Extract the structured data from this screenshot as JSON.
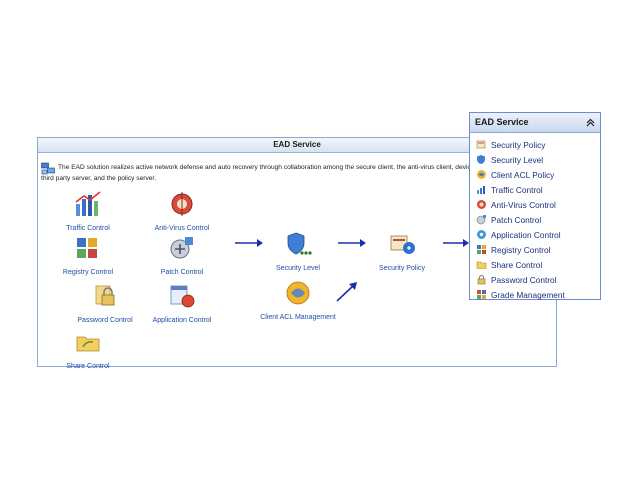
{
  "panel": {
    "title": "EAD Service",
    "intro": "The EAD solution realizes active network defense and auto recovery through collaboration among the secure client, the anti-virus client, device, the third party server, and the policy server."
  },
  "nodes": {
    "traffic": "Traffic Control",
    "antivirus": "Anti-Virus Control",
    "registry": "Registry Control",
    "patch": "Patch Control",
    "password": "Password Control",
    "application": "Application Control",
    "share": "Share Control",
    "security_level": "Security Level",
    "client_acl": "Client ACL Management",
    "security_policy": "Security Policy"
  },
  "menu": {
    "title": "EAD Service",
    "items": [
      {
        "label": "Security Policy",
        "icon": "security-policy-icon"
      },
      {
        "label": "Security Level",
        "icon": "security-level-icon"
      },
      {
        "label": "Client ACL Policy",
        "icon": "client-acl-icon"
      },
      {
        "label": "Traffic Control",
        "icon": "traffic-icon"
      },
      {
        "label": "Anti-Virus Control",
        "icon": "antivirus-icon"
      },
      {
        "label": "Patch Control",
        "icon": "patch-icon"
      },
      {
        "label": "Application Control",
        "icon": "application-icon"
      },
      {
        "label": "Registry Control",
        "icon": "registry-icon"
      },
      {
        "label": "Share Control",
        "icon": "share-icon"
      },
      {
        "label": "Password Control",
        "icon": "password-icon"
      },
      {
        "label": "Grade Management",
        "icon": "grade-icon"
      }
    ]
  },
  "colors": {
    "link": "#1f4ea8",
    "arrow": "#1a2fb0",
    "border": "#8fa8d2"
  }
}
